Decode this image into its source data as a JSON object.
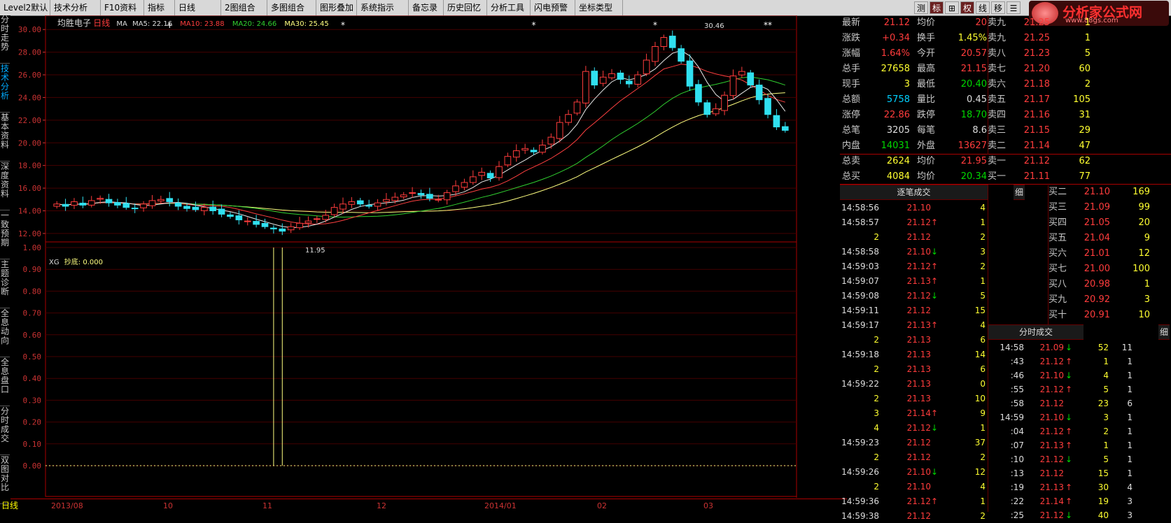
{
  "toolbar": {
    "items": [
      "Level2默认",
      "技术分析",
      "F10资料",
      "指标",
      "日线",
      "2图组合",
      "多图组合",
      "图形叠加",
      "系统指示",
      "备忘录",
      "历史回忆",
      "分析工具",
      "闪电预警",
      "坐标类型"
    ],
    "right_icons": [
      "测",
      "标",
      "⊞",
      "权",
      "线",
      "移",
      "☰"
    ],
    "logo_text": "分析家公式网",
    "logo_url": "www.88gs.com"
  },
  "sidebar": {
    "tabs": [
      "分时走势",
      "技术分析",
      "基本资料",
      "深度资料",
      "一致预期",
      "主题诊断",
      "全息动向",
      "全息盘口",
      "分时成交",
      "双图对比"
    ]
  },
  "chart": {
    "stock_name": "均胜电子",
    "period": "日线",
    "ma_title": "MA",
    "ma5": "MA5: 22.16",
    "ma10": "MA10: 23.88",
    "ma20": "MA20: 24.66",
    "ma30": "MA30: 25.45",
    "high_label": "30.46",
    "low_label": "11.95",
    "y_ticks": [
      "30.00",
      "28.00",
      "26.00",
      "24.00",
      "22.00",
      "20.00",
      "18.00",
      "16.00",
      "14.00",
      "12.00"
    ],
    "indicator_name": "XG",
    "indicator_value": "抄底: 0.000",
    "ind_ticks": [
      "1.00",
      "0.90",
      "0.80",
      "0.70",
      "0.60",
      "0.50",
      "0.40",
      "0.30",
      "0.20",
      "0.10",
      "0.00"
    ],
    "date_labels": [
      "2013/08",
      "10",
      "11",
      "12",
      "2014/01",
      "02",
      "03"
    ],
    "day_tab": "日线"
  },
  "chart_data": {
    "type": "candlestick",
    "title": "均胜电子 日线",
    "ylim": [
      11.5,
      31
    ],
    "close": [
      14.6,
      14.4,
      14.8,
      14.5,
      14.9,
      15.1,
      14.7,
      14.5,
      14.3,
      14.2,
      14.6,
      14.9,
      15.0,
      14.8,
      14.4,
      14.2,
      14.1,
      14.3,
      14.0,
      13.7,
      13.5,
      13.2,
      13.1,
      12.8,
      12.6,
      12.4,
      12.2,
      12.6,
      12.9,
      13.1,
      13.3,
      13.6,
      14.3,
      14.6,
      14.8,
      14.6,
      14.4,
      14.7,
      15.0,
      15.2,
      15.4,
      15.6,
      15.4,
      15.1,
      15.0,
      15.6,
      16.2,
      16.5,
      17.0,
      17.4,
      16.9,
      17.9,
      18.8,
      19.3,
      19.5,
      19.2,
      19.8,
      20.5,
      21.8,
      22.5,
      23.6,
      26.3,
      25.1,
      25.8,
      26.1,
      25.6,
      25.2,
      26.0,
      27.3,
      28.5,
      29.3,
      28.4,
      27.2,
      25.0,
      23.6,
      22.5,
      23.0,
      24.2,
      25.9,
      26.3,
      25.1,
      23.8,
      22.5,
      21.4,
      21.1
    ],
    "ma_series": [
      "MA5",
      "MA10",
      "MA20",
      "MA30"
    ],
    "indicator": {
      "name": "XG",
      "label": "抄底",
      "value": 0.0,
      "signals": "two bars of value 1.00 in late November 2013"
    }
  },
  "quote": {
    "rows": [
      {
        "l1": "最新",
        "v1": "21.12",
        "c1": "r",
        "l2": "均价",
        "v2": "20",
        "c2": "r",
        "l3": "卖九",
        "v3": "21.25",
        "c3": "r",
        "v4": "1"
      },
      {
        "l1": "涨跌",
        "v1": "+0.34",
        "c1": "r",
        "l2": "换手",
        "v2": "1.45%",
        "c2": "y",
        "l3": "卖九",
        "v3": "21.25",
        "c3": "r",
        "v4": "1"
      },
      {
        "l1": "涨幅",
        "v1": "1.64%",
        "c1": "r",
        "l2": "今开",
        "v2": "20.57",
        "c2": "r",
        "l3": "卖八",
        "v3": "21.23",
        "c3": "r",
        "v4": "5"
      },
      {
        "l1": "总手",
        "v1": "27658",
        "c1": "y",
        "l2": "最高",
        "v2": "21.15",
        "c2": "r",
        "l3": "卖七",
        "v3": "21.20",
        "c3": "r",
        "v4": "60"
      },
      {
        "l1": "现手",
        "v1": "3",
        "c1": "y",
        "l2": "最低",
        "v2": "20.40",
        "c2": "g",
        "l3": "卖六",
        "v3": "21.18",
        "c3": "r",
        "v4": "2"
      },
      {
        "l1": "总额",
        "v1": "5758",
        "c1": "c",
        "l2": "量比",
        "v2": "0.45",
        "c2": "w",
        "l3": "卖五",
        "v3": "21.17",
        "c3": "r",
        "v4": "105"
      },
      {
        "l1": "涨停",
        "v1": "22.86",
        "c1": "r",
        "l2": "跌停",
        "v2": "18.70",
        "c2": "g",
        "l3": "卖四",
        "v3": "21.16",
        "c3": "r",
        "v4": "31"
      },
      {
        "l1": "总笔",
        "v1": "3205",
        "c1": "w",
        "l2": "每笔",
        "v2": "8.6",
        "c2": "w",
        "l3": "卖三",
        "v3": "21.15",
        "c3": "r",
        "v4": "29"
      },
      {
        "l1": "内盘",
        "v1": "14031",
        "c1": "g",
        "l2": "外盘",
        "v2": "13627",
        "c2": "r",
        "l3": "卖二",
        "v3": "21.14",
        "c3": "r",
        "v4": "47"
      },
      {
        "l1": "总卖",
        "v1": "2624",
        "c1": "y",
        "l2": "均价",
        "v2": "21.95",
        "c2": "r",
        "l3": "卖一",
        "v3": "21.12",
        "c3": "r",
        "v4": "62"
      },
      {
        "l1": "总买",
        "v1": "4084",
        "c1": "y",
        "l2": "均价",
        "v2": "20.34",
        "c2": "g",
        "l3": "买一",
        "v3": "21.11",
        "c3": "r",
        "v4": "77"
      }
    ],
    "buy_rows": [
      {
        "l": "买二",
        "p": "21.10",
        "v": "169"
      },
      {
        "l": "买三",
        "p": "21.09",
        "v": "99"
      },
      {
        "l": "买四",
        "p": "21.05",
        "v": "20"
      },
      {
        "l": "买五",
        "p": "21.04",
        "v": "9"
      },
      {
        "l": "买六",
        "p": "21.01",
        "v": "12"
      },
      {
        "l": "买七",
        "p": "21.00",
        "v": "100"
      },
      {
        "l": "买八",
        "p": "20.98",
        "v": "1"
      },
      {
        "l": "买九",
        "p": "20.92",
        "v": "3"
      },
      {
        "l": "买十",
        "p": "20.91",
        "v": "10"
      }
    ]
  },
  "trades": {
    "header": "逐笔成交",
    "detail": "细",
    "rows": [
      {
        "t": "14:58:56",
        "p": "21.10",
        "a": "",
        "v": "4"
      },
      {
        "t": "14:58:57",
        "p": "21.12",
        "a": "↑",
        "v": "1"
      },
      {
        "t": "2",
        "p": "21.12",
        "a": "",
        "v": "2"
      },
      {
        "t": "14:58:58",
        "p": "21.10",
        "a": "↓",
        "v": "3"
      },
      {
        "t": "14:59:03",
        "p": "21.12",
        "a": "↑",
        "v": "2"
      },
      {
        "t": "14:59:07",
        "p": "21.13",
        "a": "↑",
        "v": "1"
      },
      {
        "t": "14:59:08",
        "p": "21.12",
        "a": "↓",
        "v": "5"
      },
      {
        "t": "14:59:11",
        "p": "21.12",
        "a": "",
        "v": "15"
      },
      {
        "t": "14:59:17",
        "p": "21.13",
        "a": "↑",
        "v": "4"
      },
      {
        "t": "2",
        "p": "21.13",
        "a": "",
        "v": "6"
      },
      {
        "t": "14:59:18",
        "p": "21.13",
        "a": "",
        "v": "14"
      },
      {
        "t": "2",
        "p": "21.13",
        "a": "",
        "v": "6"
      },
      {
        "t": "14:59:22",
        "p": "21.13",
        "a": "",
        "v": "0"
      },
      {
        "t": "2",
        "p": "21.13",
        "a": "",
        "v": "10"
      },
      {
        "t": "3",
        "p": "21.14",
        "a": "↑",
        "v": "9"
      },
      {
        "t": "4",
        "p": "21.12",
        "a": "↓",
        "v": "1"
      },
      {
        "t": "14:59:23",
        "p": "21.12",
        "a": "",
        "v": "37"
      },
      {
        "t": "2",
        "p": "21.12",
        "a": "",
        "v": "2"
      },
      {
        "t": "14:59:26",
        "p": "21.10",
        "a": "↓",
        "v": "12"
      },
      {
        "t": "2",
        "p": "21.10",
        "a": "",
        "v": "4"
      },
      {
        "t": "14:59:36",
        "p": "21.12",
        "a": "↑",
        "v": "1"
      },
      {
        "t": "14:59:38",
        "p": "21.12",
        "a": "",
        "v": "2"
      }
    ]
  },
  "minute_trades": {
    "header": "分时成交",
    "detail": "细",
    "rows": [
      {
        "t": "14:58",
        "p": "21.09",
        "a": "↓",
        "v": "52",
        "n": "11"
      },
      {
        "t": ":43",
        "p": "21.12",
        "a": "↑",
        "v": "1",
        "n": "1"
      },
      {
        "t": ":46",
        "p": "21.10",
        "a": "↓",
        "v": "4",
        "n": "1"
      },
      {
        "t": ":55",
        "p": "21.12",
        "a": "↑",
        "v": "5",
        "n": "1"
      },
      {
        "t": ":58",
        "p": "21.12",
        "a": "",
        "v": "23",
        "n": "6"
      },
      {
        "t": "14:59",
        "p": "21.10",
        "a": "↓",
        "v": "3",
        "n": "1"
      },
      {
        "t": ":04",
        "p": "21.12",
        "a": "↑",
        "v": "2",
        "n": "1"
      },
      {
        "t": ":07",
        "p": "21.13",
        "a": "↑",
        "v": "1",
        "n": "1"
      },
      {
        "t": ":10",
        "p": "21.12",
        "a": "↓",
        "v": "5",
        "n": "1"
      },
      {
        "t": ":13",
        "p": "21.12",
        "a": "",
        "v": "15",
        "n": "1"
      },
      {
        "t": ":19",
        "p": "21.13",
        "a": "↑",
        "v": "30",
        "n": "4"
      },
      {
        "t": ":22",
        "p": "21.14",
        "a": "↑",
        "v": "19",
        "n": "3"
      },
      {
        "t": ":25",
        "p": "21.12",
        "a": "↓",
        "v": "40",
        "n": "3"
      }
    ]
  }
}
